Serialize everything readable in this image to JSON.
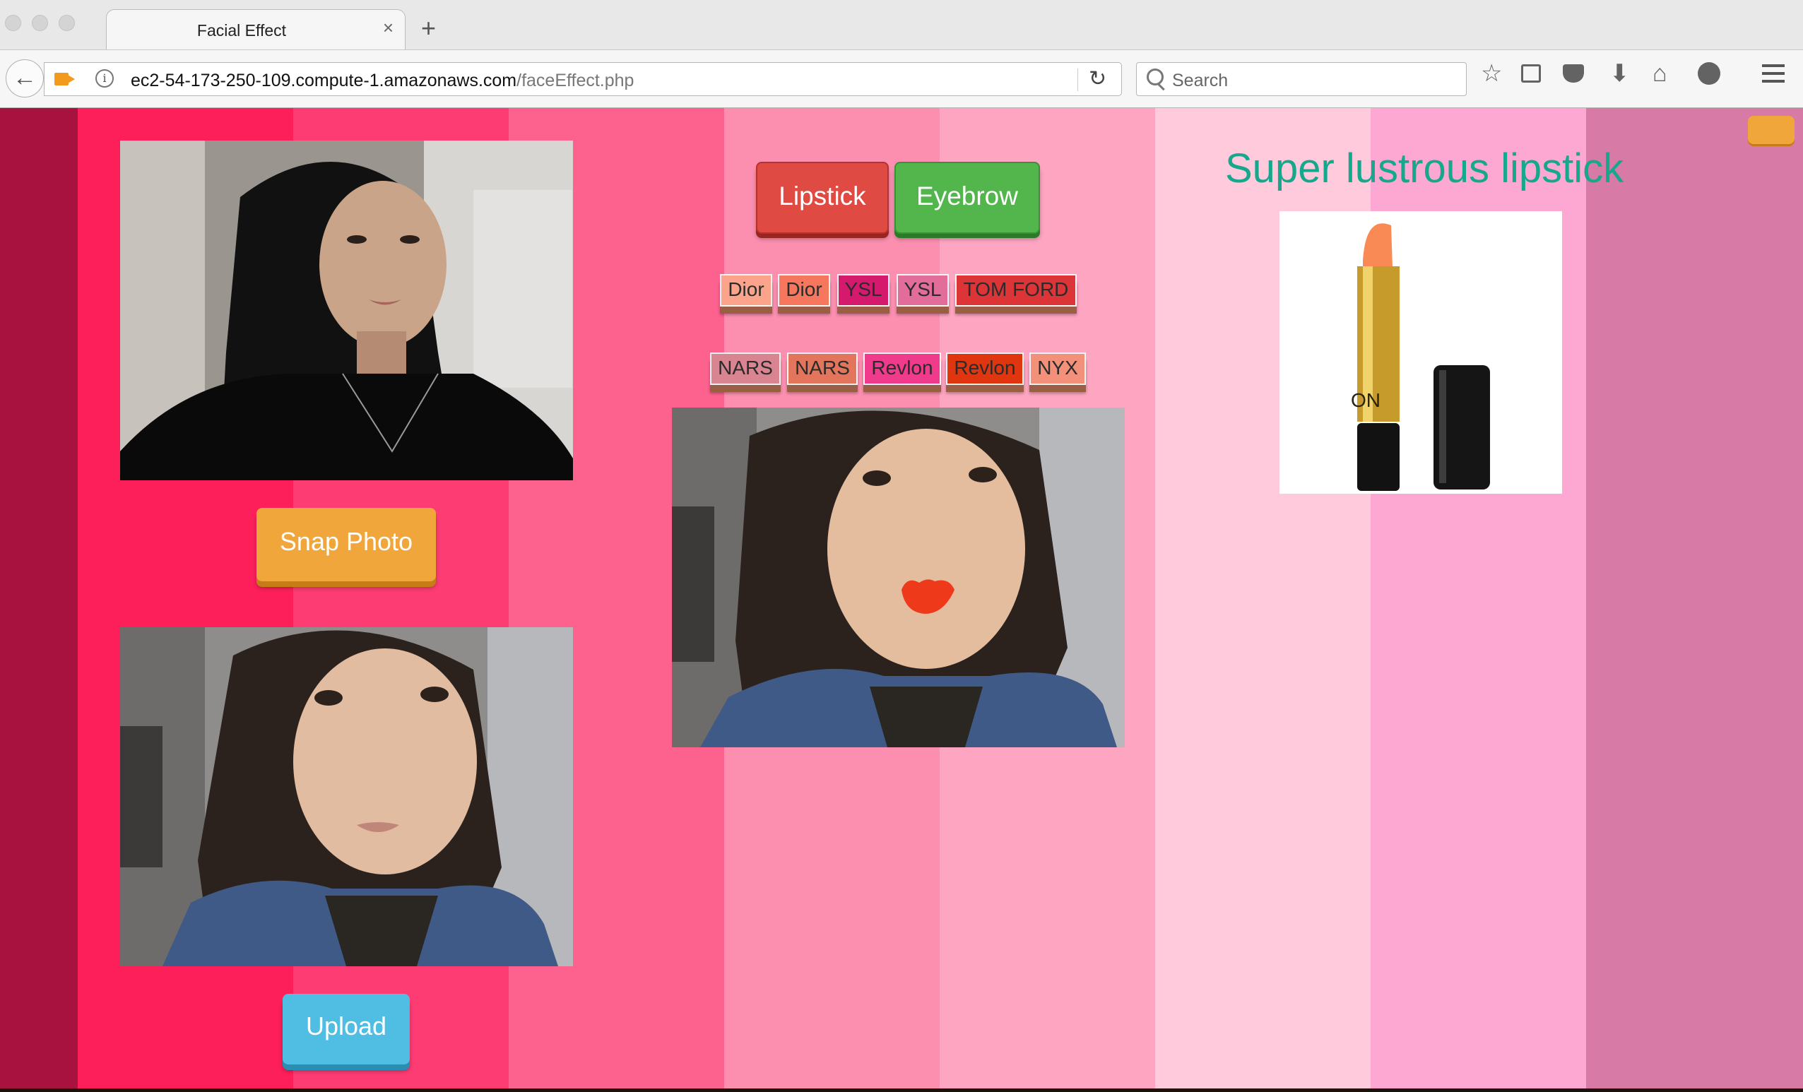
{
  "browser": {
    "tab_title": "Facial Effect",
    "tab_close": "×",
    "new_tab": "+",
    "url_host": "ec2-54-173-250-109.compute-1.amazonaws.com",
    "url_path": "/faceEffect.php",
    "search_placeholder": "Search",
    "icons": [
      "back-arrow-icon",
      "camera-icon",
      "info-icon",
      "reload-icon",
      "search-icon",
      "star-icon",
      "reading-list-icon",
      "pocket-icon",
      "download-icon",
      "home-icon",
      "smiley-icon",
      "hamburger-menu-icon"
    ]
  },
  "page": {
    "stripe_colors": [
      "#a8123f",
      "#fc1f5a",
      "#fd3c73",
      "#fd628e",
      "#fc8fb0",
      "#fda5c1",
      "#fecadc",
      "#fda8d2",
      "#d87aa6"
    ],
    "snap_label": "Snap Photo",
    "upload_label": "Upload",
    "tabs": {
      "lipstick": "Lipstick",
      "eyebrow": "Eyebrow"
    },
    "shades_row1": [
      {
        "label": "Dior",
        "color": "#fba38b"
      },
      {
        "label": "Dior",
        "color": "#f6775d"
      },
      {
        "label": "YSL",
        "color": "#d51a6d"
      },
      {
        "label": "YSL",
        "color": "#e36d9a"
      },
      {
        "label": "TOM FORD",
        "color": "#dd3438"
      }
    ],
    "shades_row2": [
      {
        "label": "NARS",
        "color": "#d98591"
      },
      {
        "label": "NARS",
        "color": "#e3755d"
      },
      {
        "label": "Revlon",
        "color": "#f03a8b"
      },
      {
        "label": "Revlon",
        "color": "#e0360f"
      },
      {
        "label": "NYX",
        "color": "#f3907a"
      }
    ],
    "product_title": "Super lustrous lipstick",
    "product_brand_text": "ON",
    "accent_colors": {
      "title": "#16a88c",
      "snap": "#f1a63b",
      "upload": "#50bee3",
      "lipstick": "#df4a43",
      "eyebrow": "#52b64d"
    }
  }
}
